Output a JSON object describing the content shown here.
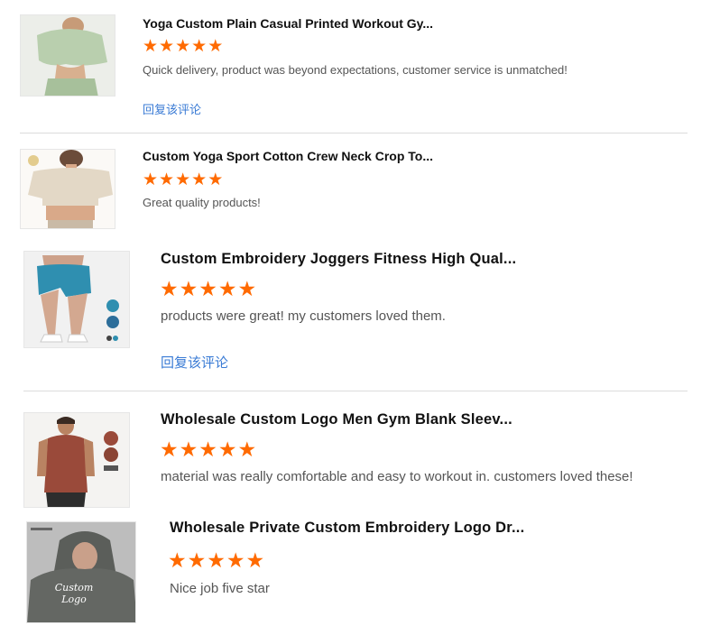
{
  "reviews": [
    {
      "product_title": "Yoga Custom Plain Casual Printed Workout Gy...",
      "rating": 5,
      "comment": "Quick delivery, product was beyond expectations, customer service is unmatched!",
      "reply_label": "回复该评论",
      "image": "sage-crop-top-photo"
    },
    {
      "product_title": "Custom Yoga Sport Cotton Crew Neck Crop To...",
      "rating": 5,
      "comment": "Great quality products!",
      "image": "beige-crop-tee-photo"
    },
    {
      "product_title": "Custom Embroidery Joggers Fitness High Qual...",
      "rating": 5,
      "comment": "products were great! my customers loved them.",
      "reply_label": "回复该评论",
      "image": "blue-shorts-photo"
    },
    {
      "product_title": "Wholesale Custom Logo Men Gym Blank Sleev...",
      "rating": 5,
      "comment": "material was really comfortable and easy to workout in. customers loved these!",
      "image": "brown-tank-top-photo"
    },
    {
      "product_title": "Wholesale Private Custom Embroidery Logo Dr...",
      "rating": 5,
      "comment": "Nice job five star",
      "image": "grey-hoodie-photo",
      "image_text": "Custom Logo"
    }
  ],
  "colors": {
    "star": "#ff6a00",
    "reply_link": "#3a7bd5",
    "divider": "#dcdcdc"
  },
  "icons": {
    "star": "star-icon"
  }
}
